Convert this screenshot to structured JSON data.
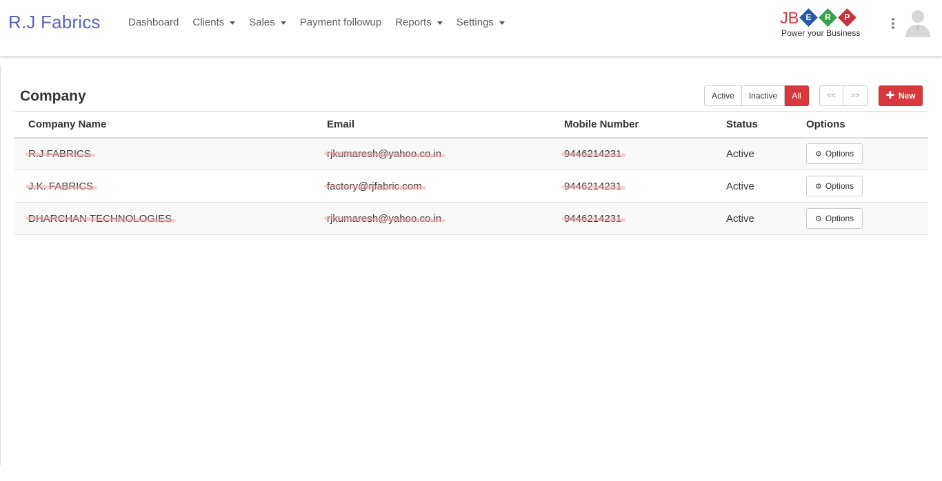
{
  "app": {
    "brand": "R.J Fabrics"
  },
  "nav": {
    "dashboard": "Dashboard",
    "clients": "Clients",
    "sales": "Sales",
    "payment_followup": "Payment followup",
    "reports": "Reports",
    "settings": "Settings"
  },
  "logo": {
    "jb": "JB",
    "e": "E",
    "r": "R",
    "p": "P",
    "tagline": "Power your Business",
    "colors": {
      "jb": "#d23a3a",
      "e": "#2a56a8",
      "r": "#3aa04a",
      "p": "#c6323b"
    }
  },
  "page": {
    "title": "Company",
    "filters": {
      "active": "Active",
      "inactive": "Inactive",
      "all": "All",
      "selected": "All"
    },
    "pager": {
      "prev": "<<",
      "next": ">>"
    },
    "new_button": "New"
  },
  "table": {
    "headers": {
      "name": "Company Name",
      "email": "Email",
      "mobile": "Mobile Number",
      "status": "Status",
      "options": "Options"
    },
    "rows": [
      {
        "name": "R.J FABRICS",
        "email": "rjkumaresh@yahoo.co.in",
        "mobile": "9446214231",
        "status": "Active",
        "options": "Options"
      },
      {
        "name": "J.K. FABRICS",
        "email": "factory@rjfabric.com",
        "mobile": "9446214231",
        "status": "Active",
        "options": "Options"
      },
      {
        "name": "DHARCHAN TECHNOLOGIES",
        "email": "rjkumaresh@yahoo.co.in",
        "mobile": "9446214231",
        "status": "Active",
        "options": "Options"
      }
    ]
  },
  "colors": {
    "brand": "#5b63b9",
    "accent": "#d9393e"
  }
}
